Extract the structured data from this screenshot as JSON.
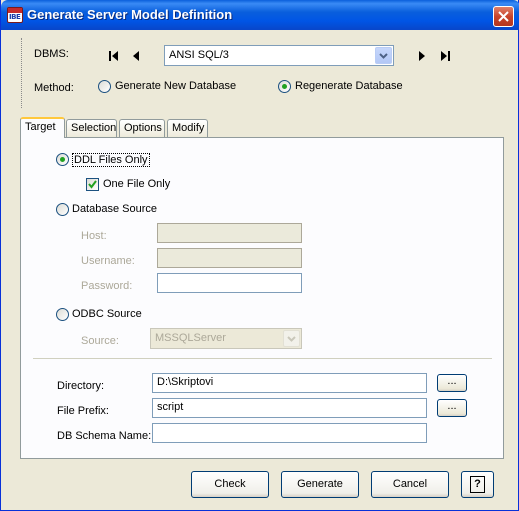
{
  "window": {
    "title": "Generate Server Model Definition",
    "app_icon_text": "IBE"
  },
  "top": {
    "dbms_label": "DBMS:",
    "dbms_value": "ANSI SQL/3",
    "method_label": "Method:",
    "method_options": [
      {
        "label": "Generate New Database",
        "checked": false
      },
      {
        "label": "Regenerate Database",
        "checked": true
      }
    ]
  },
  "tabs": [
    {
      "label": "Target",
      "active": true
    },
    {
      "label": "Selection",
      "active": false
    },
    {
      "label": "Options",
      "active": false
    },
    {
      "label": "Modify",
      "active": false
    }
  ],
  "target": {
    "ddl_files_only": {
      "label": "DDL Files Only",
      "checked": true
    },
    "one_file_only": {
      "label": "One File Only",
      "checked": true
    },
    "database_source": {
      "label": "Database Source",
      "checked": false
    },
    "host_label": "Host:",
    "host_value": "",
    "username_label": "Username:",
    "username_value": "",
    "password_label": "Password:",
    "password_value": "",
    "odbc_source": {
      "label": "ODBC Source",
      "checked": false
    },
    "source_label": "Source:",
    "source_value": "MSSQLServer",
    "directory_label": "Directory:",
    "directory_value": "D:\\Skriptovi",
    "browse_label": "...",
    "file_prefix_label": "File Prefix:",
    "file_prefix_value": "script",
    "schema_label": "DB Schema Name:",
    "schema_value": ""
  },
  "buttons": {
    "check": "Check",
    "generate": "Generate",
    "cancel": "Cancel",
    "help": "?"
  },
  "colors": {
    "titlebar": "#0a5fdc",
    "window_bg": "#ece9d8",
    "panel_bg": "#fcfcfe",
    "radio_dot": "#21a121",
    "tab_highlight": "#ffc83c"
  },
  "icons": [
    "first-record-icon",
    "prev-record-icon",
    "next-record-icon",
    "last-record-icon",
    "close-icon",
    "help-icon",
    "chevron-down-icon",
    "checkmark-icon"
  ]
}
